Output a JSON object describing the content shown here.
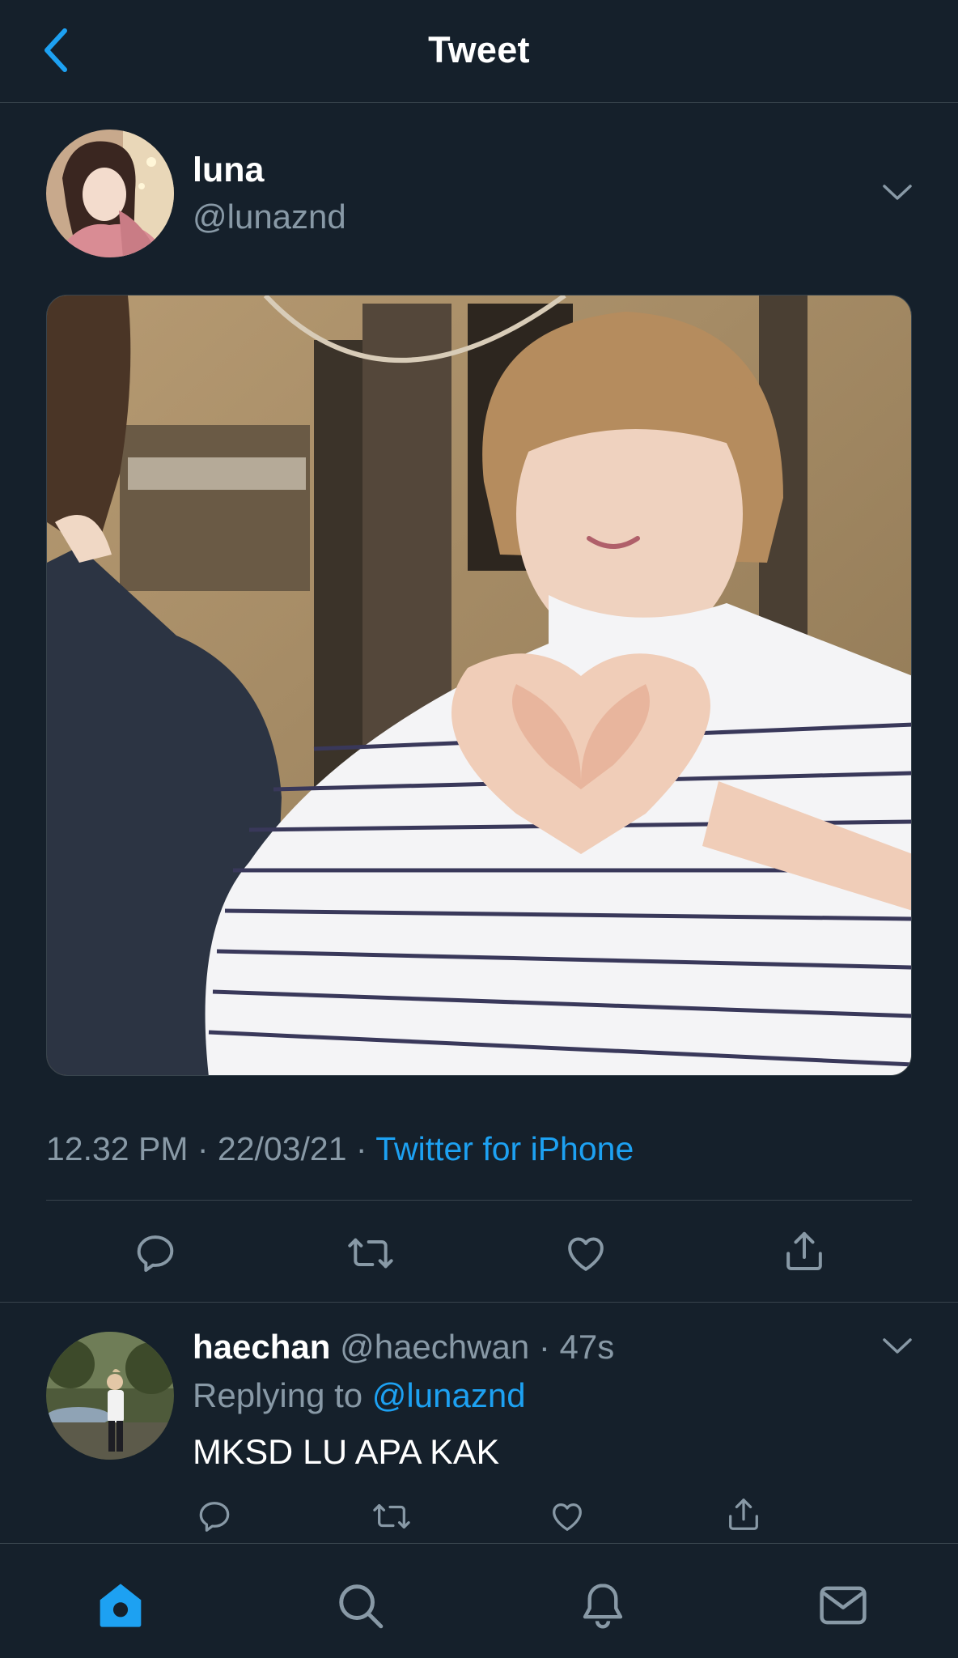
{
  "header": {
    "title": "Tweet",
    "back_icon": "chevron-left-icon"
  },
  "tweet": {
    "author_name": "luna",
    "author_handle": "@lunaznd",
    "timestamp": "12.32 PM · 22/03/21 · ",
    "source": "Twitter for iPhone",
    "actions": [
      "reply-icon",
      "retweet-icon",
      "like-icon",
      "share-icon"
    ]
  },
  "reply": {
    "author_name": "haechan",
    "author_handle": "@haechwan",
    "separator": " · ",
    "time": "47s",
    "replying_prefix": "Replying to ",
    "replying_mention": "@lunaznd",
    "text": "MKSD LU APA KAK"
  },
  "nav": [
    "home-icon",
    "search-icon",
    "notifications-icon",
    "messages-icon"
  ],
  "colors": {
    "background": "#15202b",
    "accent": "#1da1f2",
    "secondary_text": "#8899a6",
    "divider": "#38444d"
  }
}
